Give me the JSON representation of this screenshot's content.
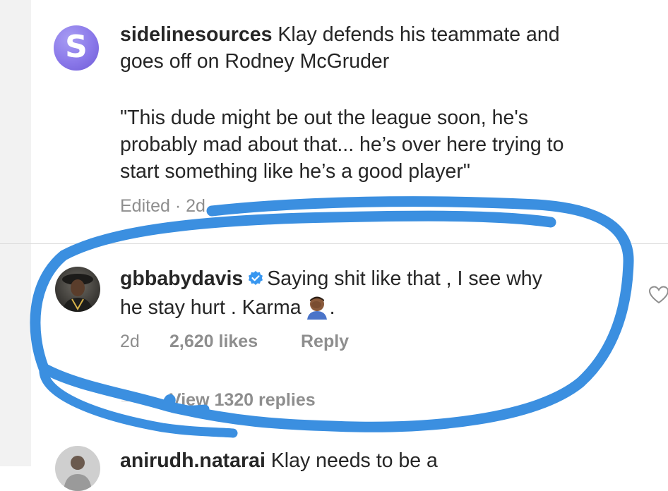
{
  "post": {
    "author": "sidelinesources",
    "caption_line1": "Klay defends his teammate and",
    "caption_line2": "goes off on Rodney McGruder",
    "quote_line1": "\"This dude might be out the league soon, he's",
    "quote_line2": "probably mad about that... he’s over here trying to",
    "quote_line3": "start something like he’s a good player\"",
    "meta": "Edited · 2d"
  },
  "comment": {
    "author": "gbbabydavis",
    "verified": true,
    "text_line1": "Saying shit like that , I see why",
    "text_line2a": "he stay hurt .  Karma",
    "text_line2b": ".",
    "time": "2d",
    "likes": "2,620 likes",
    "reply": "Reply",
    "view_replies": "View 1320 replies"
  },
  "next_comment": {
    "author": "anirudh.natarai",
    "text": "Klay needs to be a"
  },
  "colors": {
    "annotation_stroke": "#3b8fe0",
    "secondary_text": "#8e8e8e",
    "verified_badge": "#3897f0"
  }
}
